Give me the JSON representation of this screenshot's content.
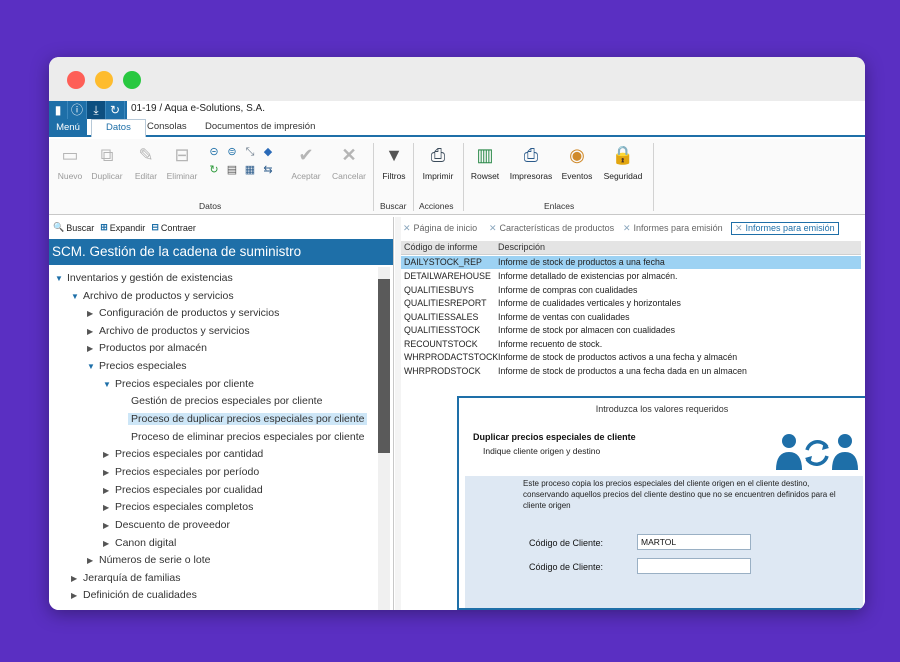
{
  "app": {
    "title": "01-19 / Aqua e-Solutions, S.A."
  },
  "quick_access": [
    "save-icon",
    "info-icon",
    "download-icon",
    "refresh-icon"
  ],
  "tabs": {
    "menu": "Menú",
    "datos": "Datos",
    "consolas": "Consolas",
    "documentos": "Documentos de impresión"
  },
  "ribbon": {
    "datos": {
      "nuevo": "Nuevo",
      "duplicar": "Duplicar",
      "editar": "Editar",
      "eliminar": "Eliminar",
      "aceptar": "Aceptar",
      "cancelar": "Cancelar",
      "group": "Datos"
    },
    "buscar": {
      "filtros": "Filtros",
      "group": "Buscar"
    },
    "acciones": {
      "imprimir": "Imprimir",
      "group": "Acciones"
    },
    "enlaces": {
      "rowset": "Rowset",
      "impresoras": "Impresoras",
      "eventos": "Eventos",
      "seguridad": "Seguridad",
      "group": "Enlaces"
    }
  },
  "tree": {
    "toolbar": {
      "buscar": "Buscar",
      "expandir": "Expandir",
      "contraer": "Contraer"
    },
    "header": "SCM. Gestión de la cadena de suministro",
    "items": [
      "Inventarios y gestión de existencias",
      "Archivo de productos y servicios",
      "Configuración de productos y servicios",
      "Archivo de productos y servicios",
      "Productos por almacén",
      "Precios especiales",
      "Precios especiales por cliente",
      "Gestión de precios especiales por cliente",
      "Proceso de duplicar precios especiales por cliente",
      "Proceso de eliminar precios especiales por cliente",
      "Precios especiales por cantidad",
      "Precios especiales por período",
      "Precios especiales por cualidad",
      "Precios especiales completos",
      "Descuento de proveedor",
      "Canon digital",
      "Números de serie o lote",
      "Jerarquía de familias",
      "Definición de cualidades"
    ]
  },
  "doc_tabs": [
    "Página de inicio",
    "Características de productos",
    "Informes para emisión",
    "Informes para emisión"
  ],
  "reports": {
    "headers": {
      "code": "Código de informe",
      "desc": "Descripción"
    },
    "rows": [
      {
        "code": "DAILYSTOCK_REP",
        "desc": "Informe de stock de productos a una fecha"
      },
      {
        "code": "DETAILWAREHOUSE",
        "desc": "Informe detallado de existencias por almacén."
      },
      {
        "code": "QUALITIESBUYS",
        "desc": "Informe de compras con cualidades"
      },
      {
        "code": "QUALITIESREPORT",
        "desc": "Informe de cualidades verticales y horizontales"
      },
      {
        "code": "QUALITIESSALES",
        "desc": "Informe de ventas con cualidades"
      },
      {
        "code": "QUALITIESSTOCK",
        "desc": "Informe de stock por almacen con cualidades"
      },
      {
        "code": "RECOUNTSTOCK",
        "desc": "Informe recuento de stock."
      },
      {
        "code": "WHRPRODACTSTOCK",
        "desc": "Informe de stock de productos activos a una fecha y almacén"
      },
      {
        "code": "WHRPRODSTOCK",
        "desc": "Informe de stock de productos a una fecha dada en un almacen"
      }
    ]
  },
  "dialog": {
    "title": "Introduzca los valores requeridos",
    "heading": "Duplicar precios especiales de cliente",
    "subheading": "Indique cliente origen y destino",
    "description": "Este proceso copia los precios especiales del cliente origen en el cliente destino, conservando aquellos precios del cliente destino que no se encuentren definidos para el cliente origen",
    "field1_label": "Código de Cliente:",
    "field1_value": "MARTOL",
    "field2_label": "Código de Cliente:",
    "field2_value": ""
  },
  "colors": {
    "accent": "#1e6fa8",
    "background": "#5a2fc2",
    "selected_row": "#9dd2f3"
  }
}
